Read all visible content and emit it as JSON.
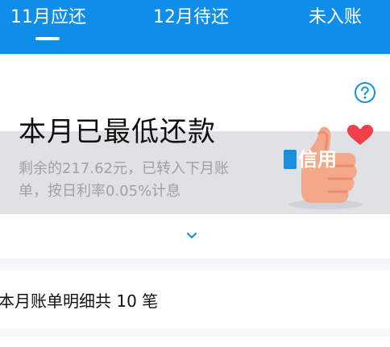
{
  "tabs": [
    {
      "label": "11月应还",
      "active": true
    },
    {
      "label": "12月待还",
      "active": false
    },
    {
      "label": "未入账",
      "active": false
    }
  ],
  "status_card": {
    "headline": "本月已最低还款",
    "subtext": "剩余的217.62元，已转入下月账单，按日利率0.05%计息",
    "help_icon": "question-circle-icon",
    "expand_icon": "chevron-down-icon",
    "illustration": "thumbs-up-heart-illustration",
    "illustration_badge_text": "信用"
  },
  "bill_details": {
    "summary": "本月账单明细共 10 笔"
  },
  "colors": {
    "brand_blue": "#0f8ee9",
    "help_icon_blue": "#1a8fe0",
    "heart_red": "#f0404a",
    "thumb_orange": "#f4a88a"
  }
}
